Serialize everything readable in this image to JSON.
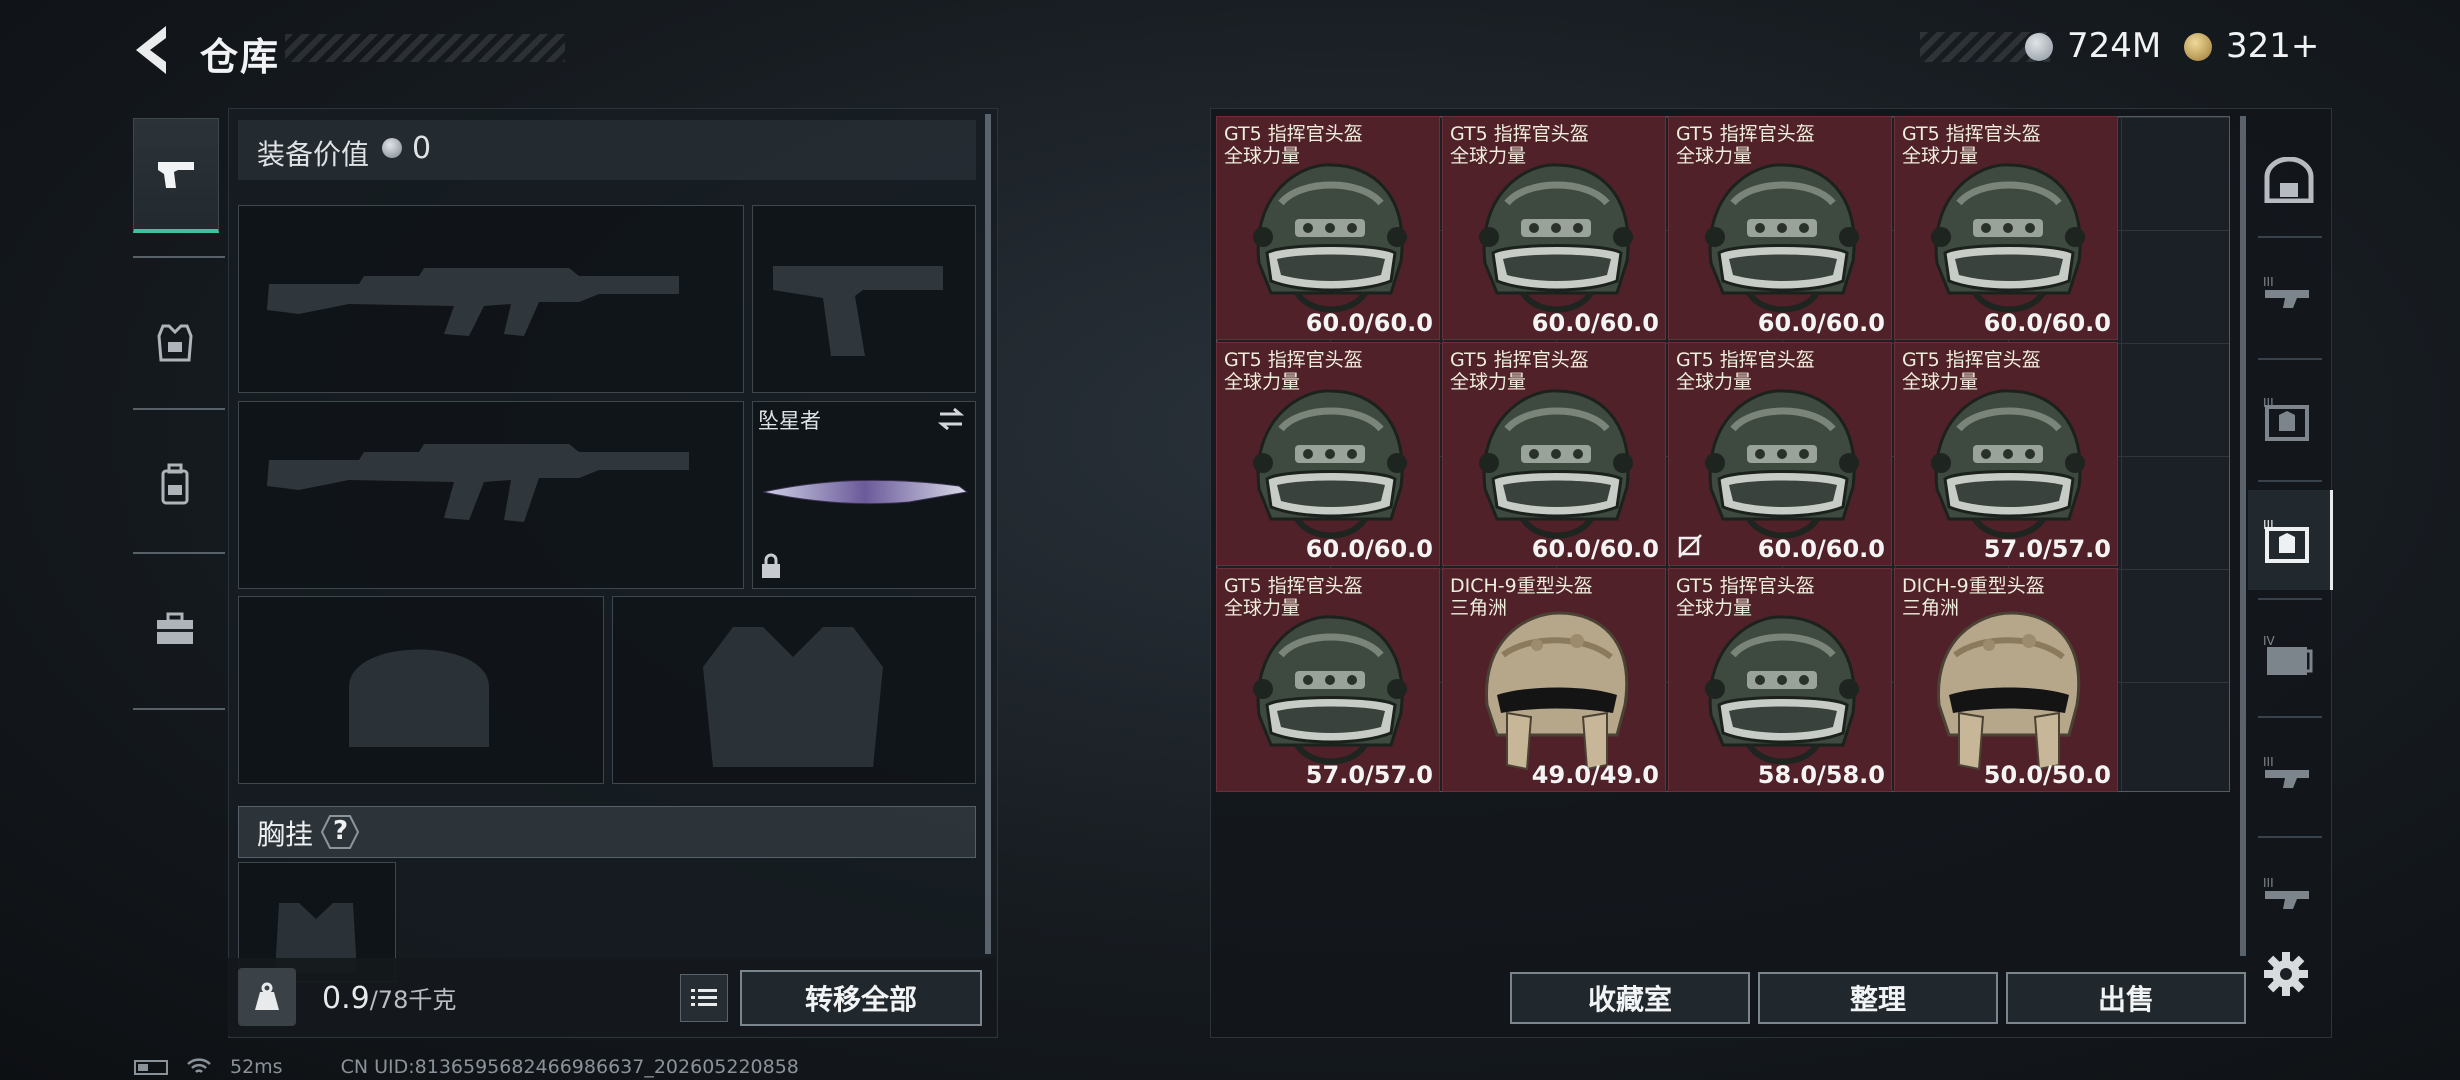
{
  "header": {
    "title": "仓库",
    "currency": {
      "money": "724M",
      "tickets": "321+"
    }
  },
  "equipment": {
    "value_label": "装备价值",
    "value": "0",
    "melee_name": "坠星者",
    "chest_rig_label": "胸挂",
    "chest_rig_help": "?",
    "weight_value": "0.9",
    "weight_max": "/78千克",
    "transfer_all": "转移全部"
  },
  "inventory": {
    "items": [
      {
        "name": "GT5 指挥官头盔",
        "sub": "全球力量",
        "durability": "60.0/60.0",
        "type": "gt5"
      },
      {
        "name": "GT5 指挥官头盔",
        "sub": "全球力量",
        "durability": "60.0/60.0",
        "type": "gt5"
      },
      {
        "name": "GT5 指挥官头盔",
        "sub": "全球力量",
        "durability": "60.0/60.0",
        "type": "gt5"
      },
      {
        "name": "GT5 指挥官头盔",
        "sub": "全球力量",
        "durability": "60.0/60.0",
        "type": "gt5"
      },
      {
        "name": "GT5 指挥官头盔",
        "sub": "全球力量",
        "durability": "60.0/60.0",
        "type": "gt5"
      },
      {
        "name": "GT5 指挥官头盔",
        "sub": "全球力量",
        "durability": "60.0/60.0",
        "type": "gt5"
      },
      {
        "name": "GT5 指挥官头盔",
        "sub": "全球力量",
        "durability": "60.0/60.0",
        "type": "gt5",
        "no_insure": true
      },
      {
        "name": "GT5 指挥官头盔",
        "sub": "全球力量",
        "durability": "57.0/57.0",
        "type": "gt5"
      },
      {
        "name": "GT5 指挥官头盔",
        "sub": "全球力量",
        "durability": "57.0/57.0",
        "type": "gt5"
      },
      {
        "name": "DICH-9重型头盔",
        "sub": "三角洲",
        "durability": "49.0/49.0",
        "type": "dich"
      },
      {
        "name": "GT5 指挥官头盔",
        "sub": "全球力量",
        "durability": "58.0/58.0",
        "type": "gt5"
      },
      {
        "name": "DICH-9重型头盔",
        "sub": "三角洲",
        "durability": "50.0/50.0",
        "type": "dich"
      }
    ]
  },
  "actions": {
    "collection": "收藏室",
    "sort": "整理",
    "sell": "出售"
  },
  "status": {
    "ping": "52ms",
    "uid": "CN UID:8136595682466986637_202605220858"
  },
  "colors": {
    "accent": "#3fc1a1",
    "item_bg": "#502128"
  }
}
